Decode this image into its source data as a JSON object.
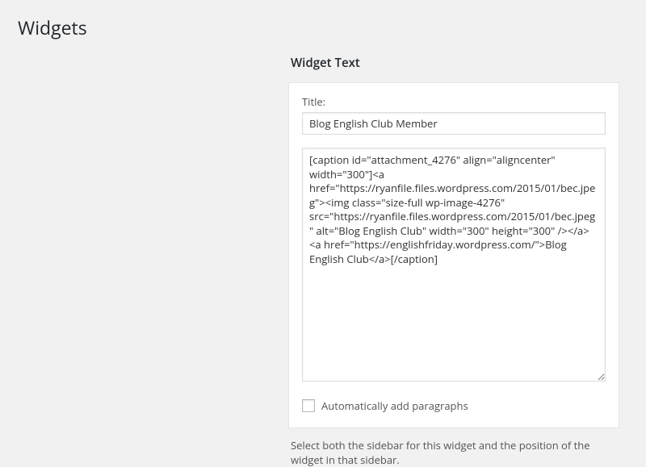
{
  "page": {
    "title": "Widgets"
  },
  "widget": {
    "heading": "Widget Text",
    "title_label": "Title:",
    "title_value": "Blog English Club Member",
    "content_value": "[caption id=\"attachment_4276\" align=\"aligncenter\" width=\"300\"]<a href=\"https://ryanfile.files.wordpress.com/2015/01/bec.jpeg\"><img class=\"size-full wp-image-4276\" src=\"https://ryanfile.files.wordpress.com/2015/01/bec.jpeg\" alt=\"Blog English Club\" width=\"300\" height=\"300\" /></a> <a href=\"https://englishfriday.wordpress.com/\">Blog English Club</a>[/caption]",
    "auto_paragraph_label": "Automatically add paragraphs",
    "helper_text": "Select both the sidebar for this widget and the position of the widget in that sidebar."
  }
}
